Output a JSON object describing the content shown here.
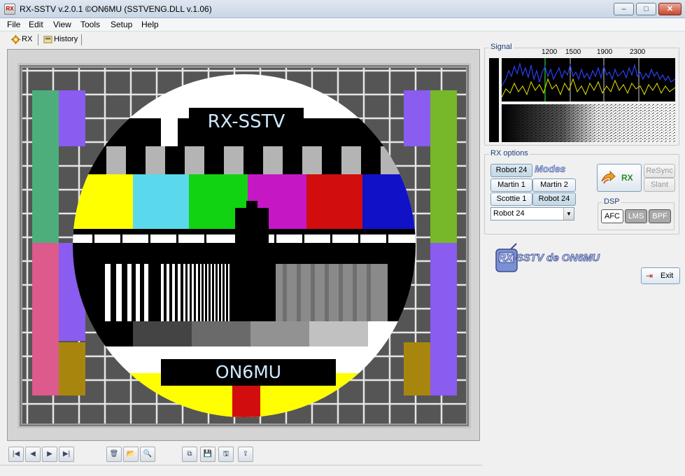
{
  "window": {
    "title": "RX-SSTV v.2.0.1 ©ON6MU (SSTVENG.DLL v.1.06)",
    "icon_text": "RX",
    "min_glyph": "▭",
    "max_glyph": "☐",
    "close_glyph": "✕"
  },
  "menu": [
    "File",
    "Edit",
    "View",
    "Tools",
    "Setup",
    "Help"
  ],
  "tabs": [
    {
      "label": "RX",
      "icon": "gear-icon"
    },
    {
      "label": "History",
      "icon": "history-icon"
    }
  ],
  "testcard": {
    "top_label": "RX-SSTV",
    "bottom_label": "ON6MU",
    "colors": {
      "bar_yellow": "#ffff00",
      "bar_cyan": "#5bd9ec",
      "bar_green": "#12d312",
      "bar_magenta": "#c517c4",
      "bar_red": "#d20d0d",
      "bar_blue": "#1111c8",
      "side_green": "#4dae7c",
      "side_purple": "#8a5cf0",
      "side_pink": "#dc5a8c",
      "side_olive": "#a8860e",
      "grid_bg": "#555555",
      "grid_line": "#e0e0e0"
    }
  },
  "signal": {
    "title": "Signal",
    "freq_labels": [
      "1200",
      "1500",
      "1900",
      "2300"
    ]
  },
  "rx_options": {
    "title": "RX options",
    "modes_logo": "Modes",
    "mode_buttons": [
      "Robot 24",
      "Martin 1",
      "Martin 2",
      "Scottie 1",
      "Robot 24"
    ],
    "selected_mode": "Robot 24",
    "rx_button": "RX",
    "resync_button": "ReSync",
    "slant_button": "Slant",
    "dsp_title": "DSP",
    "dsp_buttons": [
      "AFC",
      "LMS",
      "BPF"
    ]
  },
  "logo_text": "RX-SSTV de ON6MU",
  "exit_button": "Exit",
  "toolbar_icons": [
    "first-icon",
    "prev-icon",
    "next-icon",
    "last-icon",
    "delete-icon",
    "open-icon",
    "zoom-icon",
    "copy-icon",
    "save-icon",
    "save-as-icon",
    "export-icon"
  ],
  "toolbar_glyphs": [
    "|◀",
    "◀",
    "▶",
    "▶|",
    "🗑",
    "📂",
    "🔍",
    "⧉",
    "💾",
    "🖫",
    "⇪"
  ]
}
